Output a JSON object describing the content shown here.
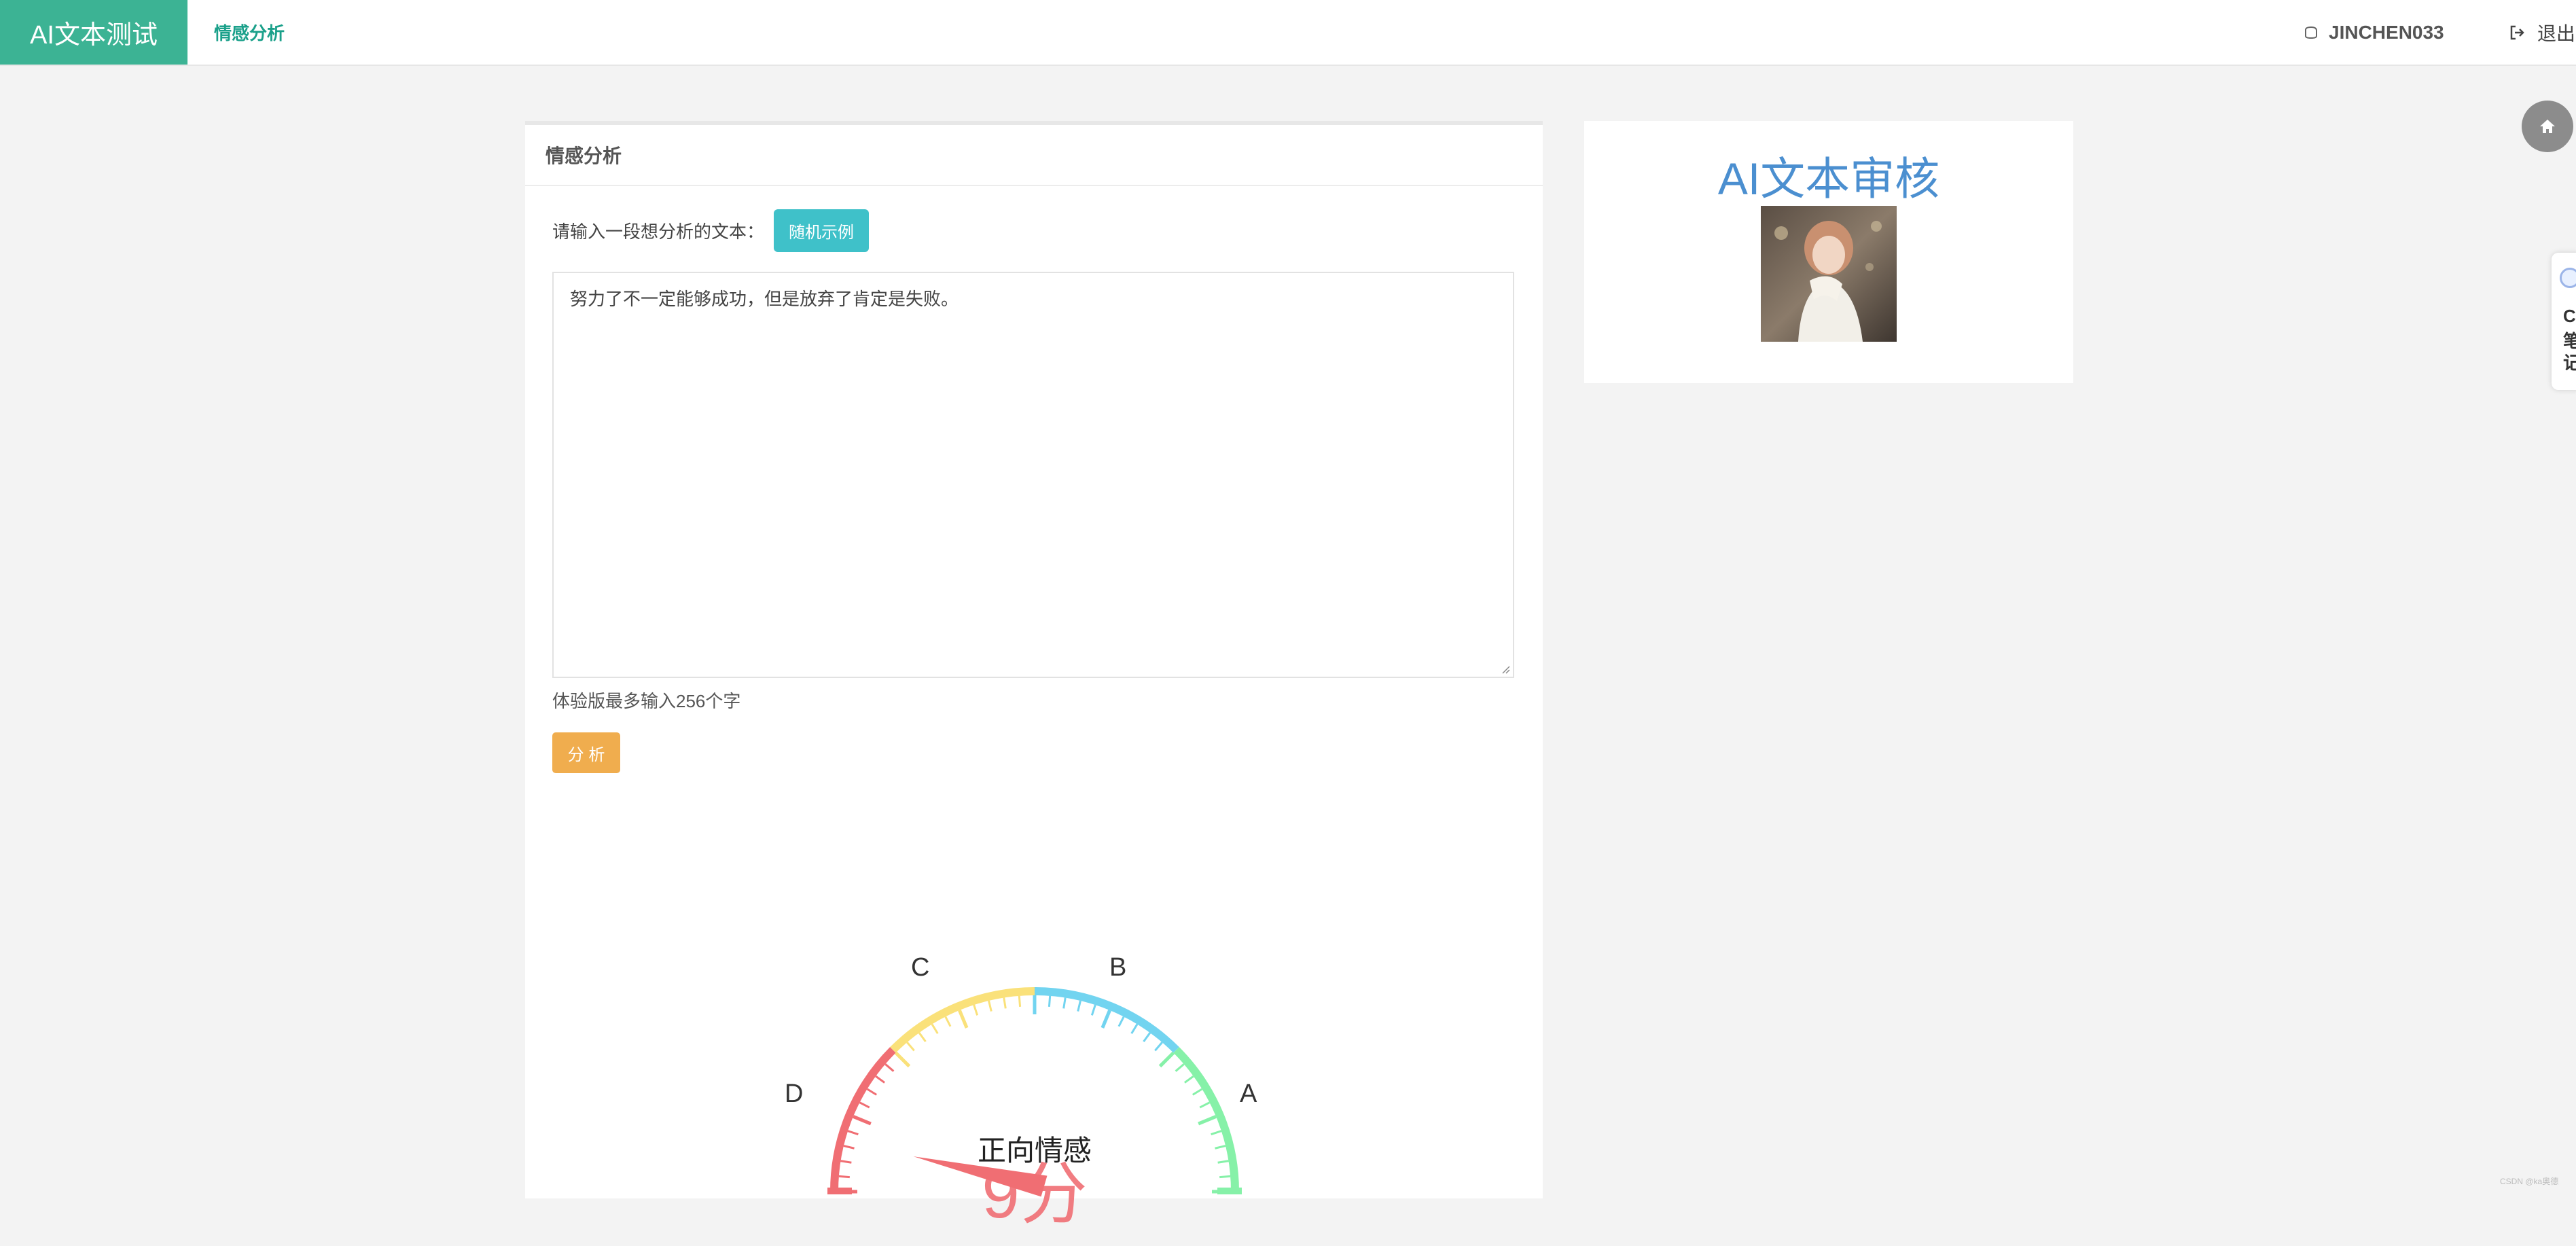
{
  "header": {
    "brand": "AI文本测试",
    "nav_item": "情感分析",
    "username": "JINCHEN033",
    "logout": "退出"
  },
  "panel": {
    "title": "情感分析",
    "prompt_label": "请输入一段想分析的文本：",
    "example_button": "随机示例",
    "input_text": "努力了不一定能够成功，但是放弃了肯定是失败。",
    "hint": "体验版最多输入256个字",
    "analyze_button": "分 析"
  },
  "gauge": {
    "grade_labels": [
      "D",
      "C",
      "B",
      "A"
    ],
    "title": "正向情感",
    "value": 9,
    "unit": "分",
    "value_text": "9分",
    "min": 0,
    "max": 100,
    "colors": [
      "#f06e73",
      "#fae17a",
      "#72d4f0",
      "#86f1a8"
    ],
    "value_color": "#f06e73"
  },
  "side": {
    "title": "AI文本审核"
  },
  "float_card": {
    "chars": [
      "C",
      "笔",
      "记"
    ]
  },
  "watermark": "CSDN @ka奥德"
}
